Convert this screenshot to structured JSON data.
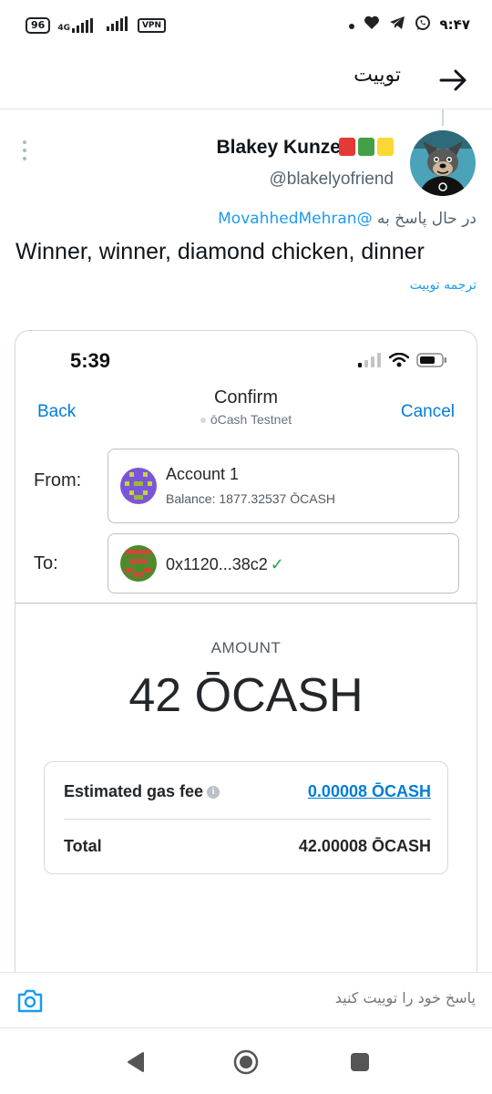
{
  "status_bar": {
    "battery": "96",
    "network": "4G",
    "vpn": "VPN",
    "time": "۹:۴۷"
  },
  "header": {
    "title": "توییت"
  },
  "tweet": {
    "author_name": "Blakey Kunze",
    "author_handle": "@blakelyofriend",
    "name_flag_colors": [
      "#e53935",
      "#43a047",
      "#fdd835"
    ],
    "reply_prefix": "در حال پاسخ به",
    "reply_mention": "@MovahhedMehran",
    "text": "Winner, winner, diamond chicken, dinner",
    "translate_label": "ترجمه توییت"
  },
  "embedded": {
    "ios_time": "5:39",
    "back_label": "Back",
    "cancel_label": "Cancel",
    "title": "Confirm",
    "network": "ōCash Testnet",
    "from_label": "From:",
    "to_label": "To:",
    "from_account": {
      "name": "Account 1",
      "balance": "Balance: 1877.32537 ŌCASH"
    },
    "to_address": "0x1120...38c2",
    "to_check": "✓",
    "amount_label": "AMOUNT",
    "amount_value": "42 ŌCASH",
    "gas_label": "Estimated gas fee",
    "gas_value": "0.00008 ŌCASH",
    "total_label": "Total",
    "total_value": "42.00008 ŌCASH",
    "accent_color": "#037dd6"
  },
  "reply_bar": {
    "placeholder": "پاسخ خود را توییت کنید"
  },
  "colors": {
    "twitter_blue": "#1d9bf0",
    "muted_text": "#536471"
  }
}
